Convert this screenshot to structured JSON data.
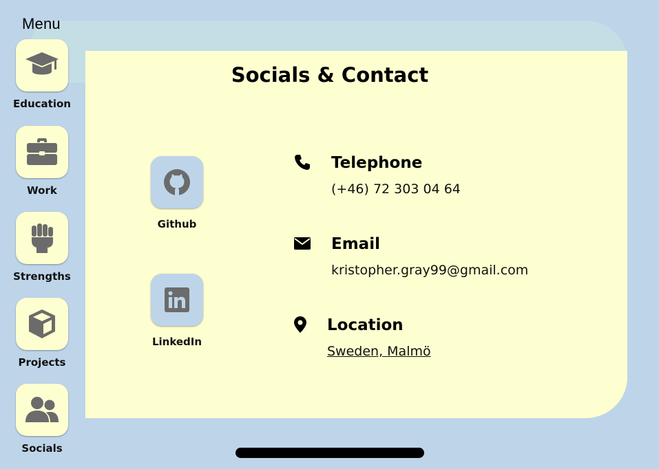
{
  "header": {
    "menu_label": "Menu"
  },
  "nav": {
    "items": [
      {
        "label": "Education",
        "icon": "graduation-cap-icon"
      },
      {
        "label": "Work",
        "icon": "briefcase-icon"
      },
      {
        "label": "Strengths",
        "icon": "fist-icon"
      },
      {
        "label": "Projects",
        "icon": "cube-icon"
      },
      {
        "label": "Socials",
        "icon": "users-icon"
      }
    ]
  },
  "page": {
    "title": "Socials & Contact"
  },
  "socials": [
    {
      "label": "Github",
      "icon": "github-icon"
    },
    {
      "label": "LinkedIn",
      "icon": "linkedin-icon"
    }
  ],
  "contact": {
    "telephone": {
      "heading": "Telephone",
      "value": "(+46) 72 303 04 64",
      "icon": "phone-icon"
    },
    "email": {
      "heading": "Email",
      "value": "kristopher.gray99@gmail.com",
      "icon": "envelope-icon"
    },
    "location": {
      "heading": "Location",
      "value": "Sweden, Malmö",
      "icon": "map-pin-icon"
    }
  },
  "colors": {
    "background": "#bed5e9",
    "card": "#feffd0",
    "icon_gray": "#6b6b6b"
  }
}
